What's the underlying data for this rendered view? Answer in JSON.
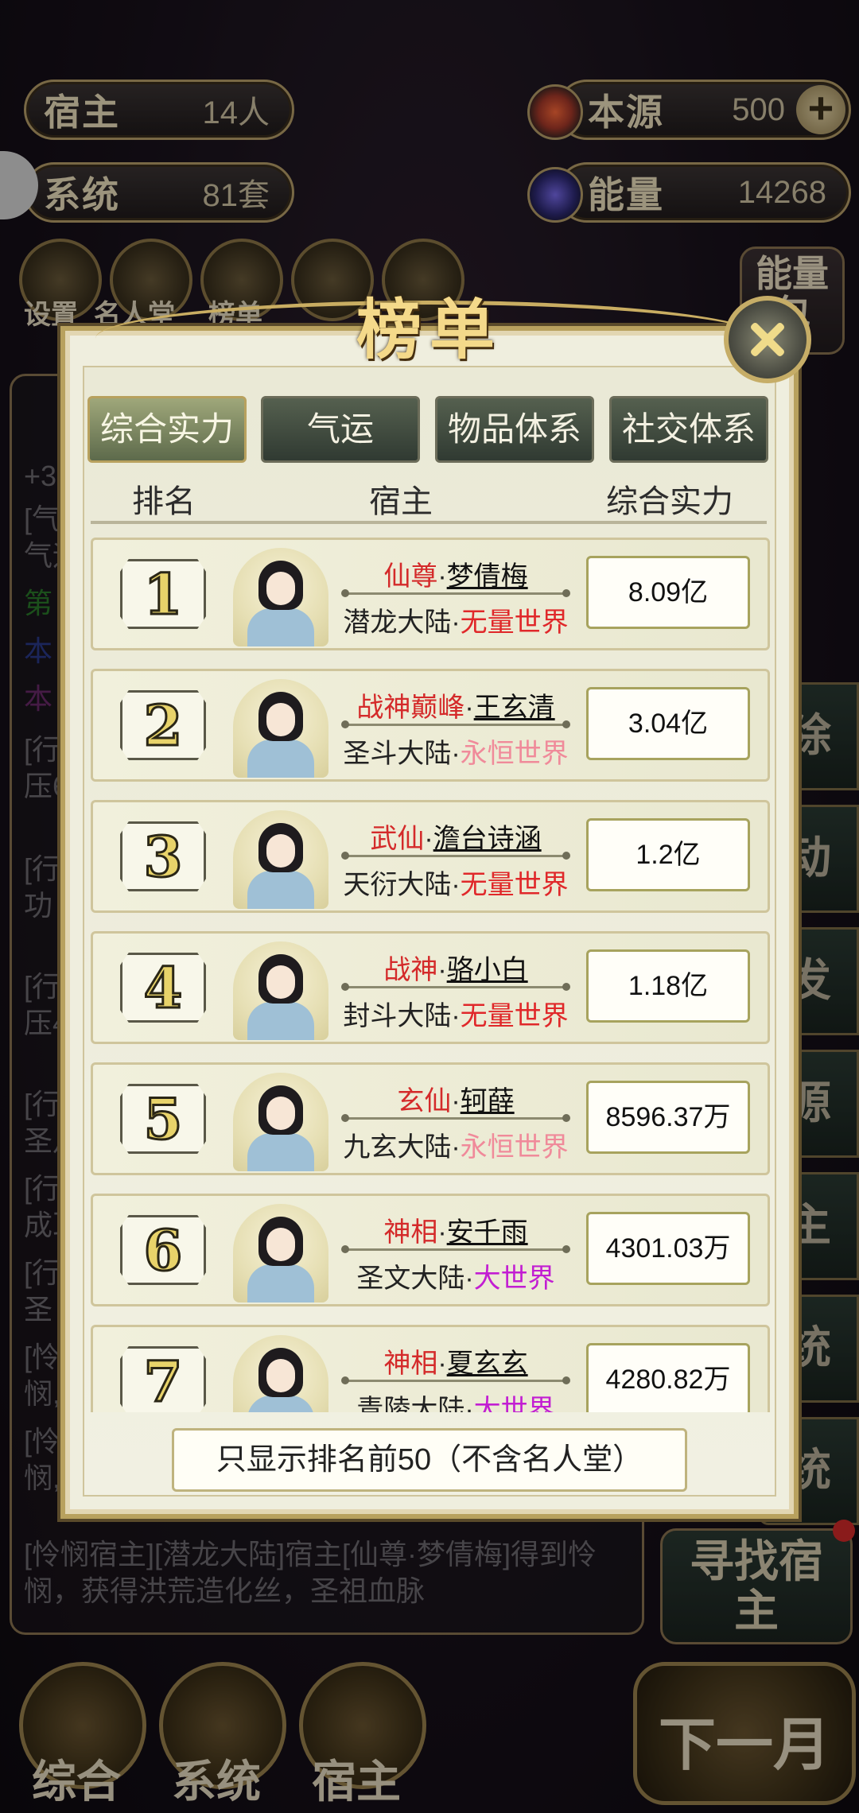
{
  "top_stats": {
    "host_label": "宿主",
    "host_value": "14人",
    "source_label": "本源",
    "source_value": "500",
    "system_label": "系统",
    "system_value": "81套",
    "energy_label": "能量",
    "energy_value": "14268"
  },
  "top_icons": [
    "设置",
    "名人堂",
    "榜单"
  ],
  "energy_pack": "能量包",
  "background_log": [
    "+3",
    "[气",
    "气运",
    "第",
    "本",
    "本",
    "[行",
    "压6",
    "[行",
    "功",
    "[行",
    "压4",
    "[行",
    "圣月",
    "[行",
    "成耳",
    "[行",
    "圣",
    "[怜",
    "悯,",
    "[怜",
    "悯,"
  ],
  "background_bottom_log": "[怜悯宿主][潜龙大陆]宿主[仙尊·梦倩梅]得到怜悯，获得洪荒造化丝，圣祖血脉",
  "side_buttons": [
    "除",
    "动",
    "发",
    "源",
    "主",
    "统",
    "统"
  ],
  "find_host_button": "寻找宿主",
  "next_month_button": "下一月",
  "bottom_nav": [
    "综合",
    "系统",
    "宿主"
  ],
  "modal": {
    "title": "榜单",
    "tabs": [
      "综合实力",
      "气运",
      "物品体系",
      "社交体系"
    ],
    "active_tab": 0,
    "columns": {
      "rank": "排名",
      "host": "宿主",
      "power": "综合实力"
    },
    "rows": [
      {
        "rank": "1",
        "title": "仙尊",
        "name": "梦倩梅",
        "continent": "潜龙大陆",
        "world": "无量世界",
        "world_color": "#e0282a",
        "power": "8.09亿"
      },
      {
        "rank": "2",
        "title": "战神巅峰",
        "name": "王玄清",
        "continent": "圣斗大陆",
        "world": "永恒世界",
        "world_color": "#f08a9a",
        "power": "3.04亿"
      },
      {
        "rank": "3",
        "title": "武仙",
        "name": "澹台诗涵",
        "continent": "天衍大陆",
        "world": "无量世界",
        "world_color": "#e0282a",
        "power": "1.2亿"
      },
      {
        "rank": "4",
        "title": "战神",
        "name": "骆小白",
        "continent": "封斗大陆",
        "world": "无量世界",
        "world_color": "#e0282a",
        "power": "1.18亿"
      },
      {
        "rank": "5",
        "title": "玄仙",
        "name": "轲薛",
        "continent": "九玄大陆",
        "world": "永恒世界",
        "world_color": "#f08a9a",
        "power": "8596.37万"
      },
      {
        "rank": "6",
        "title": "神相",
        "name": "安千雨",
        "continent": "圣文大陆",
        "world": "大世界",
        "world_color": "#c21ed2",
        "power": "4301.03万"
      },
      {
        "rank": "7",
        "title": "神相",
        "name": "夏玄玄",
        "continent": "青陵大陆",
        "world": "大世界",
        "world_color": "#c21ed2",
        "power": "4280.82万"
      }
    ],
    "footer": "只显示排名前50（不含名人堂）"
  }
}
